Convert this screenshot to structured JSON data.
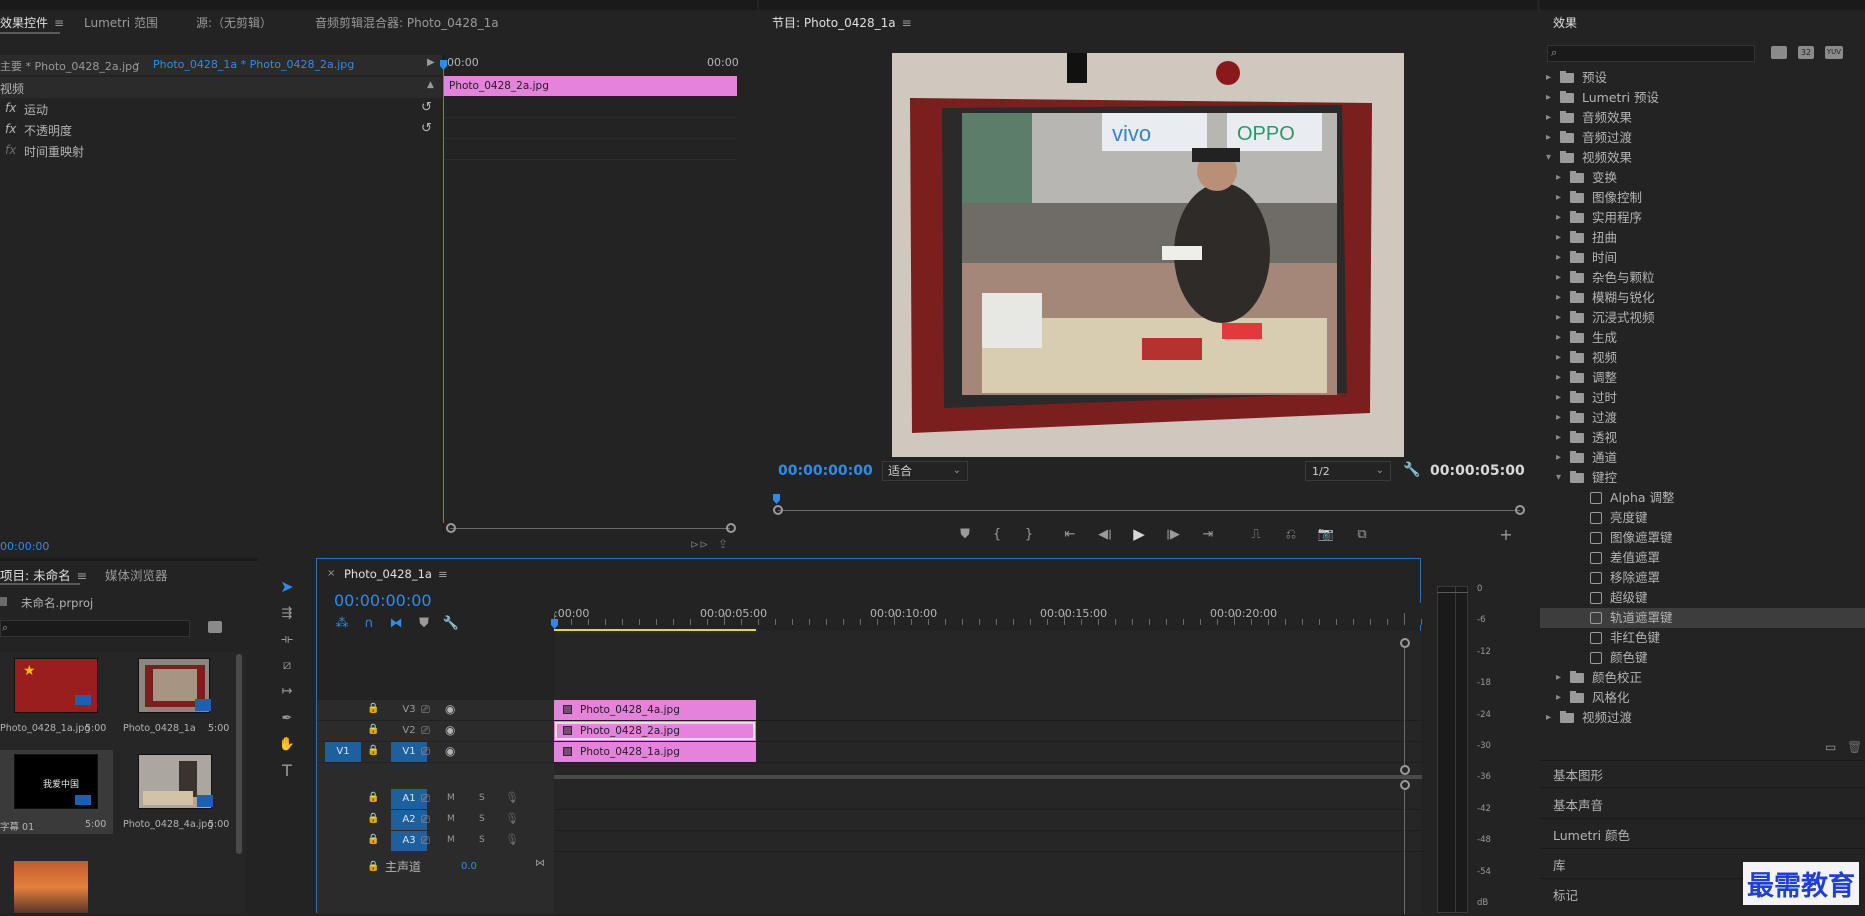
{
  "effect_controls": {
    "tabs": [
      "效果控件",
      "Lumetri 范围",
      "源:（无剪辑）",
      "音频剪辑混合器: Photo_0428_1a"
    ],
    "source_clip": "主要 * Photo_0428_2a.jpg",
    "sequence_clip": "Photo_0428_1a * Photo_0428_2a.jpg",
    "section": "视频",
    "items": [
      "运动",
      "不透明度",
      "时间重映射"
    ],
    "ruler_start": "00:00",
    "ruler_end": "00:00",
    "clip_label": "Photo_0428_2a.jpg",
    "timecode": "00:00:00"
  },
  "program": {
    "title": "节目: Photo_0428_1a",
    "timecode": "00:00:00:00",
    "fit": "适合",
    "resolution": "1/2",
    "duration": "00:00:05:00",
    "image_signs": [
      "vivo",
      "OPPO"
    ]
  },
  "effects": {
    "title": "效果",
    "search_placeholder": "",
    "header_icons": [
      "32",
      "YUV"
    ],
    "tree": [
      {
        "label": "预设",
        "level": 0,
        "arrow": "▸",
        "kind": "folder"
      },
      {
        "label": "Lumetri 预设",
        "level": 0,
        "arrow": "▸",
        "kind": "folder"
      },
      {
        "label": "音频效果",
        "level": 0,
        "arrow": "▸",
        "kind": "folder"
      },
      {
        "label": "音频过渡",
        "level": 0,
        "arrow": "▸",
        "kind": "folder"
      },
      {
        "label": "视频效果",
        "level": 0,
        "arrow": "▾",
        "kind": "folder"
      },
      {
        "label": "变换",
        "level": 1,
        "arrow": "▸",
        "kind": "folder"
      },
      {
        "label": "图像控制",
        "level": 1,
        "arrow": "▸",
        "kind": "folder"
      },
      {
        "label": "实用程序",
        "level": 1,
        "arrow": "▸",
        "kind": "folder"
      },
      {
        "label": "扭曲",
        "level": 1,
        "arrow": "▸",
        "kind": "folder"
      },
      {
        "label": "时间",
        "level": 1,
        "arrow": "▸",
        "kind": "folder"
      },
      {
        "label": "杂色与颗粒",
        "level": 1,
        "arrow": "▸",
        "kind": "folder"
      },
      {
        "label": "模糊与锐化",
        "level": 1,
        "arrow": "▸",
        "kind": "folder"
      },
      {
        "label": "沉浸式视频",
        "level": 1,
        "arrow": "▸",
        "kind": "folder"
      },
      {
        "label": "生成",
        "level": 1,
        "arrow": "▸",
        "kind": "folder"
      },
      {
        "label": "视频",
        "level": 1,
        "arrow": "▸",
        "kind": "folder"
      },
      {
        "label": "调整",
        "level": 1,
        "arrow": "▸",
        "kind": "folder"
      },
      {
        "label": "过时",
        "level": 1,
        "arrow": "▸",
        "kind": "folder"
      },
      {
        "label": "过渡",
        "level": 1,
        "arrow": "▸",
        "kind": "folder"
      },
      {
        "label": "透视",
        "level": 1,
        "arrow": "▸",
        "kind": "folder"
      },
      {
        "label": "通道",
        "level": 1,
        "arrow": "▸",
        "kind": "folder"
      },
      {
        "label": "键控",
        "level": 1,
        "arrow": "▾",
        "kind": "folder"
      },
      {
        "label": "Alpha 调整",
        "level": 2,
        "arrow": "",
        "kind": "fx"
      },
      {
        "label": "亮度键",
        "level": 2,
        "arrow": "",
        "kind": "fx"
      },
      {
        "label": "图像遮罩键",
        "level": 2,
        "arrow": "",
        "kind": "fx"
      },
      {
        "label": "差值遮罩",
        "level": 2,
        "arrow": "",
        "kind": "fx"
      },
      {
        "label": "移除遮罩",
        "level": 2,
        "arrow": "",
        "kind": "fx"
      },
      {
        "label": "超级键",
        "level": 2,
        "arrow": "",
        "kind": "fx"
      },
      {
        "label": "轨道遮罩键",
        "level": 2,
        "arrow": "",
        "kind": "fx",
        "selected": true
      },
      {
        "label": "非红色键",
        "level": 2,
        "arrow": "",
        "kind": "fx"
      },
      {
        "label": "颜色键",
        "level": 2,
        "arrow": "",
        "kind": "fx"
      },
      {
        "label": "颜色校正",
        "level": 1,
        "arrow": "▸",
        "kind": "folder"
      },
      {
        "label": "风格化",
        "level": 1,
        "arrow": "▸",
        "kind": "folder"
      },
      {
        "label": "视频过渡",
        "level": 0,
        "arrow": "▸",
        "kind": "folder"
      }
    ],
    "panels": [
      "基本图形",
      "基本声音",
      "Lumetri 颜色",
      "库",
      "标记"
    ]
  },
  "project": {
    "tabs": [
      "项目: 未命名",
      "媒体浏览器"
    ],
    "file": "未命名.prproj",
    "items": [
      {
        "caption": "Photo_0428_1a.jpg",
        "duration": "5:00"
      },
      {
        "caption": "Photo_0428_1a",
        "duration": "5:00"
      },
      {
        "caption": "字幕 01",
        "duration": "5:00",
        "overlay": "我爱中国"
      },
      {
        "caption": "Photo_0428_4a.jpg",
        "duration": "5:00"
      }
    ]
  },
  "timeline": {
    "sequence_tab": "Photo_0428_1a",
    "timecode": "00:00:00:00",
    "ruler": [
      ":00:00",
      "00:00:05:00",
      "00:00:10:00",
      "00:00:15:00",
      "00:00:20:00"
    ],
    "video_tracks": [
      {
        "name": "V3",
        "clip": "Photo_0428_4a.jpg"
      },
      {
        "name": "V2",
        "clip": "Photo_0428_2a.jpg"
      },
      {
        "name": "V1",
        "clip": "Photo_0428_1a.jpg",
        "source": "V1"
      }
    ],
    "audio_tracks": [
      "A1",
      "A2",
      "A3"
    ],
    "audio_buttons": [
      "M",
      "S"
    ],
    "master_label": "主声道",
    "master_value": "0.0"
  },
  "meter": {
    "scale": [
      "0",
      "-6",
      "-12",
      "-18",
      "-24",
      "-30",
      "-36",
      "-42",
      "-48",
      "-54",
      "dB"
    ]
  },
  "watermark": "最需教育",
  "colors": {
    "accent": "#2d8ceb",
    "clip": "#e583dc",
    "track_sel": "#1e5f9d"
  }
}
